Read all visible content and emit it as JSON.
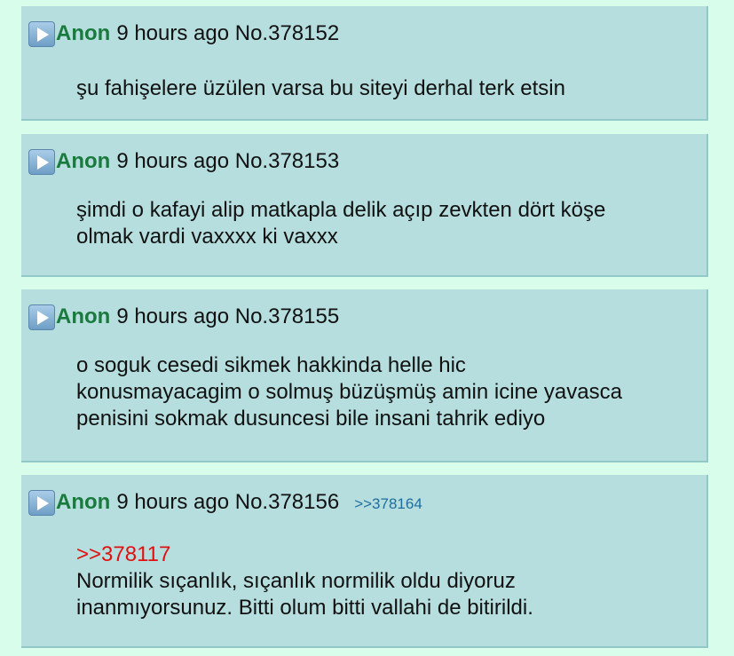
{
  "posts": [
    {
      "name": "Anon",
      "time": "9 hours ago",
      "number": "No.378152",
      "lines": [
        "şu fahişelere üzülen varsa bu siteyi derhal terk etsin"
      ]
    },
    {
      "name": "Anon",
      "time": "9 hours ago",
      "number": "No.378153",
      "lines": [
        "şimdi o kafayi alip matkapla delik açıp zevkten dört köşe",
        "olmak vardi vaxxxx ki vaxxx"
      ]
    },
    {
      "name": "Anon",
      "time": "9 hours ago",
      "number": "No.378155",
      "lines": [
        "o soguk cesedi sikmek hakkinda helle hic",
        "konusmayacagim o solmuş büzüşmüş amin icine yavasca",
        "penisini sokmak dusuncesi bile insani tahrik ediyo"
      ]
    },
    {
      "name": "Anon",
      "time": "9 hours ago",
      "number": "No.378156",
      "backlink": ">>378164",
      "quote": ">>378117",
      "lines": [
        "Normilik sıçanlık, sıçanlık normilik oldu diyoruz",
        "inanmıyorsunuz. Bitti olum bitti vallahi de bitirildi."
      ]
    }
  ],
  "colors": {
    "page_background": "#d8fdea",
    "post_background": "#b6dede",
    "name": "#1a7a3e",
    "quote_link": "#e01010",
    "backlink": "#1f6d9e"
  },
  "icons": {
    "post_icon": "play-icon"
  }
}
